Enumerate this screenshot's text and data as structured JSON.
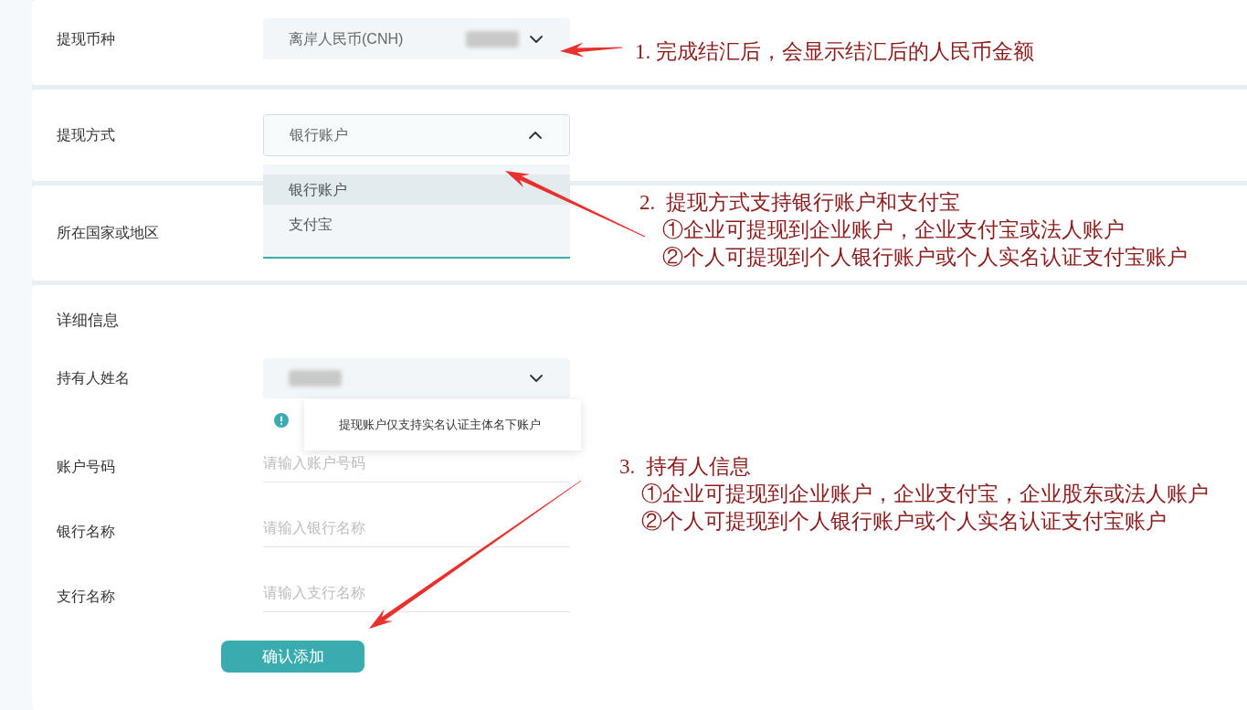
{
  "form": {
    "sections": [
      {
        "kind": "select",
        "label": "提现币种",
        "value": "离岸人民币(CNH)",
        "redacted": true,
        "expanded": false
      },
      {
        "kind": "select",
        "label": "提现方式",
        "value": "银行账户",
        "expanded": true,
        "options": [
          {
            "label": "银行账户",
            "selected": true
          },
          {
            "label": "支付宝",
            "selected": false
          }
        ]
      },
      {
        "label": "所在国家或地区"
      }
    ]
  },
  "details": {
    "title": "详细信息",
    "fields": [
      {
        "kind": "select",
        "label": "持有人姓名",
        "redacted": true,
        "expanded": false,
        "hint": "提现账户仅支持实名认证主体名下账户"
      },
      {
        "kind": "input",
        "label": "账户号码",
        "placeholder": "请输入账户号码"
      },
      {
        "kind": "input",
        "label": "银行名称",
        "placeholder": "请输入银行名称"
      },
      {
        "kind": "input",
        "label": "支行名称",
        "placeholder": "请输入支行名称"
      }
    ],
    "submit": "确认添加"
  },
  "annotations": [
    {
      "title": "1. 完成结汇后，会显示结汇后的人民币金额"
    },
    {
      "title": "2.  提现方式支持银行账户和支付宝",
      "items": [
        "①企业可提现到企业账户，企业支付宝或法人账户",
        "②个人可提现到个人银行账户或个人实名认证支付宝账户"
      ]
    },
    {
      "title": "3.  持有人信息",
      "items": [
        "①企业可提现到企业账户，企业支付宝，企业股东或法人账户",
        "②个人可提现到个人银行账户或个人实名认证支付宝账户"
      ]
    }
  ]
}
